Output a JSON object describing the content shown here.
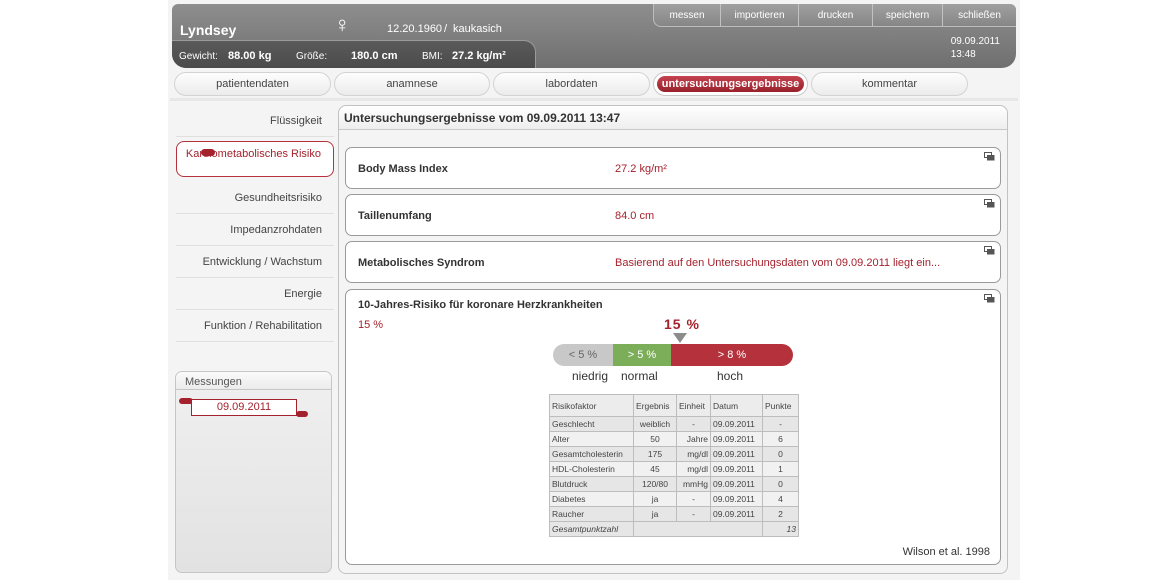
{
  "header": {
    "patient_name": "Lyndsey",
    "gender_symbol": "♀",
    "birthdate": "12.20.1960",
    "separator": "/",
    "ethnicity": "kaukasich",
    "weight_label": "Gewicht:",
    "weight_value": "88.00 kg",
    "height_label": "Größe:",
    "height_value": "180.0 cm",
    "bmi_label": "BMI:",
    "bmi_value": "27.2 kg/m²",
    "date": "09.09.2011",
    "time": "13:48",
    "menu": [
      "messen",
      "importieren",
      "drucken",
      "speichern",
      "schließen"
    ]
  },
  "tabs": [
    {
      "label": "patientendaten",
      "active": false
    },
    {
      "label": "anamnese",
      "active": false
    },
    {
      "label": "labordaten",
      "active": false
    },
    {
      "label": "untersuchungsergebnisse",
      "active": true
    },
    {
      "label": "kommentar",
      "active": false
    }
  ],
  "sidebar": {
    "items": [
      {
        "label": "Flüssigkeit"
      },
      {
        "label": "Kardiometabolisches Risiko",
        "active": true
      },
      {
        "label": "Gesundheitsrisiko"
      },
      {
        "label": "Impedanzrohdaten"
      },
      {
        "label": "Entwicklung / Wachstum"
      },
      {
        "label": "Energie"
      },
      {
        "label": "Funktion / Rehabilitation"
      }
    ],
    "measurements_title": "Messungen",
    "measurements": [
      "09.09.2011"
    ]
  },
  "main": {
    "title": "Untersuchungsergebnisse vom  09.09.2011 13:47",
    "cards": [
      {
        "label": "Body Mass Index",
        "value": "27.2 kg/m²"
      },
      {
        "label": "Taillenumfang",
        "value": "84.0 cm"
      },
      {
        "label": "Metabolisches Syndrom",
        "value": "Basierend auf den Untersuchungsdaten vom 09.09.2011 liegt ein..."
      }
    ],
    "risk": {
      "title": "10-Jahres-Risiko für koronare Herzkrankheiten",
      "value": "15 %",
      "marker_value": "15 %",
      "scale": {
        "low": "< 5 %",
        "normal": "> 5 %",
        "high": "> 8 %",
        "low_label": "niedrig",
        "normal_label": "normal",
        "high_label": "hoch"
      },
      "table": {
        "headers": [
          "Risikofaktor",
          "Ergebnis",
          "Einheit",
          "Datum",
          "Punkte"
        ],
        "rows": [
          [
            "Geschlecht",
            "weiblich",
            "-",
            "09.09.2011",
            "-"
          ],
          [
            "Alter",
            "50",
            "Jahre",
            "09.09.2011",
            "6"
          ],
          [
            "Gesamtcholesterin",
            "175",
            "mg/dl",
            "09.09.2011",
            "0"
          ],
          [
            "HDL-Cholesterin",
            "45",
            "mg/dl",
            "09.09.2011",
            "1"
          ],
          [
            "Blutdruck",
            "120/80",
            "mmHg",
            "09.09.2011",
            "0"
          ],
          [
            "Diabetes",
            "ja",
            "-",
            "09.09.2011",
            "4"
          ],
          [
            "Raucher",
            "ja",
            "-",
            "09.09.2011",
            "2"
          ]
        ],
        "total_label": "Gesamtpunktzahl",
        "total_value": "13"
      },
      "citation": "Wilson et al. 1998"
    }
  },
  "colors": {
    "accent": "#a4222d",
    "header_bg": "#7f7f7f",
    "normal_green": "#7cae59",
    "low_gray": "#c8c8c8"
  }
}
